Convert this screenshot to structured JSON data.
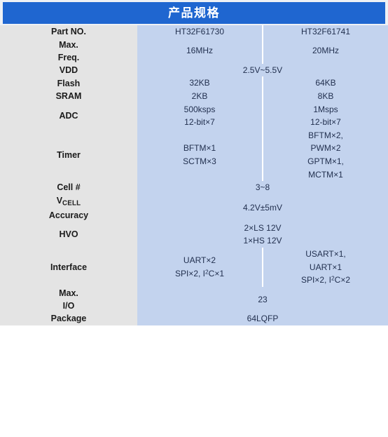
{
  "header": {
    "title": "产品规格"
  },
  "colors": {
    "banner_blue": "#1f66d0",
    "label_gray": "#e4e4e4",
    "value_blue": "#c3d3ee",
    "value_text": "#22304f",
    "label_text": "#1b1b1b",
    "grid_white": "#ffffff",
    "page_background": "#ffffff"
  },
  "table": {
    "columns": [
      "",
      "HT32F61730",
      "HT32F61741"
    ],
    "rows": [
      {
        "label": "Part NO.",
        "merged": false,
        "a": "HT32F61730",
        "b": "HT32F61741"
      },
      {
        "label_lines": [
          "Max.",
          "Freq."
        ],
        "merged": false,
        "a": "16MHz",
        "b": "20MHz"
      },
      {
        "label": "VDD",
        "merged": true,
        "value": "2.5V~5.5V"
      },
      {
        "label": "Flash",
        "merged": false,
        "a": "32KB",
        "b": "64KB"
      },
      {
        "label": "SRAM",
        "merged": false,
        "a": "2KB",
        "b": "8KB"
      },
      {
        "label": "ADC",
        "merged": false,
        "a_lines": [
          "500ksps",
          "12-bit×7"
        ],
        "b_lines": [
          "1Msps",
          "12-bit×7"
        ]
      },
      {
        "label": "Timer",
        "merged": false,
        "a_lines": [
          "BFTM×1",
          "SCTM×3"
        ],
        "b_lines": [
          "BFTM×2,",
          "PWM×2",
          "GPTM×1,",
          "MCTM×1"
        ]
      },
      {
        "label": "Cell #",
        "merged": true,
        "value": "3~8"
      },
      {
        "label_rich": "V_CELL Accuracy",
        "label_main": "V",
        "label_sub": "CELL",
        "label_second_line": "Accuracy",
        "merged": true,
        "value": "4.2V±5mV"
      },
      {
        "label": "HVO",
        "merged": true,
        "value_lines": [
          "2×LS 12V",
          "1×HS 12V"
        ]
      },
      {
        "label": "Interface",
        "merged": false,
        "a_lines": [
          "UART×2",
          "SPI×2, I2C×1"
        ],
        "b_lines": [
          "USART×1,",
          "UART×1",
          "SPI×2, I2C×2"
        ],
        "a_line2_parts": [
          "SPI×2, I",
          "2",
          "C×1"
        ],
        "b_line3_parts": [
          "SPI×2, I",
          "2",
          "C×2"
        ]
      },
      {
        "label_lines": [
          "Max.",
          "I/O"
        ],
        "merged": true,
        "value": "23"
      },
      {
        "label": "Package",
        "merged": true,
        "value": "64LQFP"
      }
    ]
  }
}
